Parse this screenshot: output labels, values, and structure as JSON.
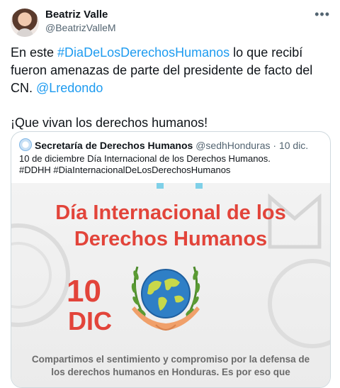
{
  "author": {
    "name": "Beatriz Valle",
    "handle": "@BeatrizValleM",
    "more_icon": "ellipsis-icon"
  },
  "tweet": {
    "line1_prefix": "En este ",
    "hashtag": "#DiaDeLosDerechosHumanos",
    "line1_suffix": " lo que recibí fueron amenazas de parte del presidente de facto del CN. ",
    "mention": "@Lredondo",
    "paragraph2": "¡Que vivan los derechos humanos!"
  },
  "quoted": {
    "name": "Secretaría de Derechos Humanos",
    "handle": "@sedhHonduras",
    "separator": "·",
    "date": "10 dic.",
    "text_line1": "10 de diciembre Día Internacional de los Derechos Humanos.",
    "text_line2": "#DDHH #DiaInternacionalDeLosDerechosHumanos"
  },
  "media": {
    "title_line1": "Día Internacional de los",
    "title_line2": "Derechos Humanos",
    "day": "10",
    "month": "DIC",
    "body_line1": "Compartimos el sentimiento y compromiso por la defensa de",
    "body_line2": "los derechos humanos en Honduras. Es por eso que",
    "accent_color": "#e2443a",
    "globe_icon": "globe-in-hands-icon"
  },
  "colors": {
    "link": "#1d9bf0",
    "secondary_text": "#536471",
    "border": "#cfd9de"
  }
}
